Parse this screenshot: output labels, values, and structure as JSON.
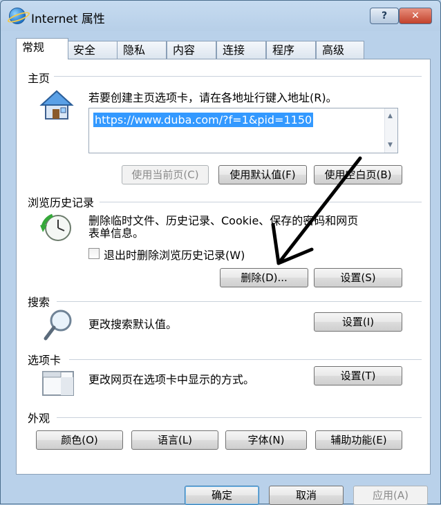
{
  "window": {
    "title": "Internet 属性",
    "help_label": "?",
    "close_label": "✕"
  },
  "tabs": [
    "常规",
    "安全",
    "隐私",
    "内容",
    "连接",
    "程序",
    "高级"
  ],
  "homepage": {
    "section_title": "主页",
    "description": "若要创建主页选项卡，请在各地址行键入地址(R)。",
    "url": "https://www.duba.com/?f=1&pid=1150",
    "use_current_label": "使用当前页(C)",
    "use_default_label": "使用默认值(F)",
    "use_blank_label": "使用空白页(B)"
  },
  "history": {
    "section_title": "浏览历史记录",
    "description_line1": "删除临时文件、历史记录、Cookie、保存的密码和网页",
    "description_line2": "表单信息。",
    "checkbox_label": "退出时删除浏览历史记录(W)",
    "delete_label": "删除(D)...",
    "settings_label": "设置(S)"
  },
  "search": {
    "section_title": "搜索",
    "description": "更改搜索默认值。",
    "settings_label": "设置(I)"
  },
  "tabs_section": {
    "section_title": "选项卡",
    "description": "更改网页在选项卡中显示的方式。",
    "settings_label": "设置(T)"
  },
  "appearance": {
    "section_title": "外观",
    "colors_label": "颜色(O)",
    "languages_label": "语言(L)",
    "fonts_label": "字体(N)",
    "accessibility_label": "辅助功能(E)"
  },
  "footer": {
    "ok_label": "确定",
    "cancel_label": "取消",
    "apply_label": "应用(A)"
  },
  "annotation": {
    "arrow_color": "#000000"
  }
}
